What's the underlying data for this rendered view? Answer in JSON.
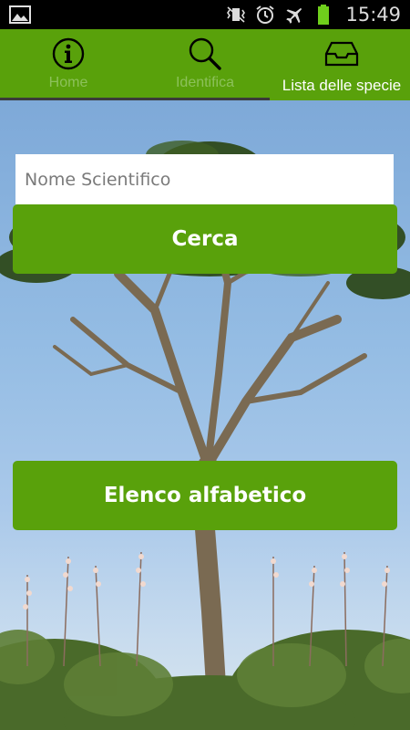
{
  "status_bar": {
    "time": "15:49",
    "icons": [
      "gallery-icon",
      "vibrate-icon",
      "alarm-icon",
      "airplane-mode-icon",
      "battery-icon"
    ],
    "battery_color": "#6fcf1c"
  },
  "tabs": [
    {
      "label": "Home",
      "icon": "info-icon",
      "active": false
    },
    {
      "label": "Identifica",
      "icon": "search-icon",
      "active": false
    },
    {
      "label": "Lista delle specie",
      "icon": "inbox-tray-icon",
      "active": true
    }
  ],
  "search": {
    "placeholder": "Nome Scientifico",
    "value": ""
  },
  "buttons": {
    "search_label": "Cerca",
    "alphabetical_label": "Elenco alfabetico"
  },
  "colors": {
    "accent": "#59a10b",
    "inactive_tab_text": "#8cc15a",
    "active_tab_text": "#ffffff"
  }
}
